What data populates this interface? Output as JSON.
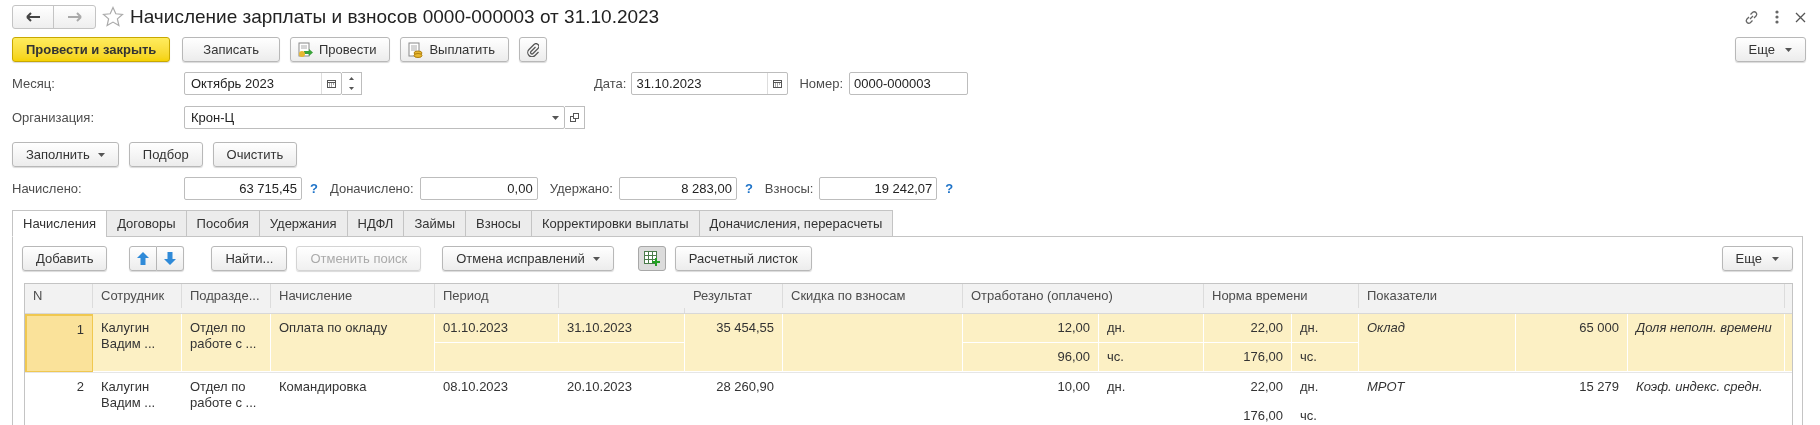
{
  "window": {
    "title": "Начисление зарплаты и взносов 0000-000003 от 31.10.2023"
  },
  "toolbar": [
    {
      "kind": "primary",
      "label": "Провести и закрыть"
    },
    {
      "kind": "plain",
      "label": "Записать"
    },
    {
      "kind": "post",
      "label": "Провести"
    },
    {
      "kind": "pay",
      "label": "Выплатить"
    },
    {
      "kind": "attach"
    }
  ],
  "more_button": "Еще",
  "month": {
    "label": "Месяц:",
    "value": "Октябрь 2023"
  },
  "date": {
    "label": "Дата:",
    "value": "31.10.2023"
  },
  "number": {
    "label": "Номер:",
    "value": "0000-000003"
  },
  "organization": {
    "label": "Организация:",
    "value": "Крон-Ц"
  },
  "fill_buttons": [
    {
      "label": "Заполнить",
      "dropdown": true
    },
    {
      "label": "Подбор",
      "dropdown": false
    },
    {
      "label": "Очистить",
      "dropdown": false
    }
  ],
  "totals": [
    {
      "label": "Начислено:",
      "value": "63 715,45",
      "help": "?"
    },
    {
      "label": "Доначислено:",
      "value": "0,00"
    },
    {
      "label": "Удержано:",
      "value": "8 283,00",
      "help": "?"
    },
    {
      "label": "Взносы:",
      "value": "19 242,07",
      "help": "?"
    }
  ],
  "tabs": [
    {
      "label": "Начисления",
      "selected": true
    },
    {
      "label": "Договоры",
      "selected": false
    },
    {
      "label": "Пособия",
      "selected": false
    },
    {
      "label": "Удержания",
      "selected": false
    },
    {
      "label": "НДФЛ",
      "selected": false
    },
    {
      "label": "Займы",
      "selected": false
    },
    {
      "label": "Взносы",
      "selected": false
    },
    {
      "label": "Корректировки выплаты",
      "selected": false
    },
    {
      "label": "Доначисления, перерасчеты",
      "selected": false
    }
  ],
  "table_toolbar": [
    {
      "kind": "text",
      "label": "Добавить",
      "disabled": false,
      "dropdown": false
    },
    {
      "kind": "move"
    },
    {
      "kind": "text",
      "label": "Найти...",
      "disabled": false,
      "dropdown": false
    },
    {
      "kind": "text",
      "label": "Отменить поиск",
      "disabled": true,
      "dropdown": false
    },
    {
      "kind": "text",
      "label": "Отмена исправлений",
      "disabled": false,
      "dropdown": true
    },
    {
      "kind": "grid"
    },
    {
      "kind": "text",
      "label": "Расчетный листок",
      "disabled": false,
      "dropdown": false
    }
  ],
  "table_more_button": "Еще",
  "table": {
    "columns": [
      "N",
      "Сотрудник",
      "Подразде...",
      "Начисление",
      "Период",
      "Результат",
      "Скидка по взносам",
      "Отработано (оплачено)",
      "Норма времени",
      "Показатели"
    ],
    "rows": [
      {
        "selected": true,
        "n": "1",
        "employee": "Калугин Вадим ...",
        "department": "Отдел по работе с ...",
        "accrual": "Оплата по окладу",
        "period_start": "01.10.2023",
        "period_end": "31.10.2023",
        "result": "35 454,55",
        "worked": [
          {
            "value": "12,00",
            "unit": "дн."
          },
          {
            "value": "96,00",
            "unit": "чс."
          }
        ],
        "norm": [
          {
            "value": "22,00",
            "unit": "дн."
          },
          {
            "value": "176,00",
            "unit": "чс."
          }
        ],
        "indicators": [
          "Оклад",
          "65 000",
          "Доля неполн. времени"
        ]
      },
      {
        "selected": false,
        "n": "2",
        "employee": "Калугин Вадим ...",
        "department": "Отдел по работе с ...",
        "accrual": "Командировка",
        "period_start": "08.10.2023",
        "period_end": "20.10.2023",
        "result": "28 260,90",
        "worked": [
          {
            "value": "10,00",
            "unit": "дн."
          }
        ],
        "norm": [
          {
            "value": "22,00",
            "unit": "дн."
          },
          {
            "value": "176,00",
            "unit": "чс."
          }
        ],
        "indicators": [
          "МРОТ",
          "15 279",
          "Коэф. индекс. средн."
        ]
      }
    ]
  }
}
